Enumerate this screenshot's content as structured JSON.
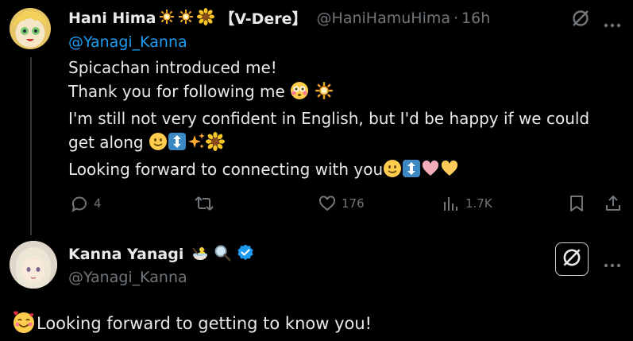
{
  "post1": {
    "author_name": "Hani Hima",
    "name_tag": "【V-Dere】",
    "handle": "@HaniHamuHima",
    "separator": "·",
    "time": "16h",
    "reply_to": "@Yanagi_Kanna",
    "lines": [
      "Spicachan introduced me!",
      "Thank you for following me",
      "I'm still not very confident in English, but I'd be happy if we could",
      "get along",
      "Looking forward to connecting with you"
    ],
    "actions": {
      "reply_count": "4",
      "retweet_count": "",
      "like_count": "176",
      "view_count": "1.7K"
    }
  },
  "post2": {
    "author_name": "Kanna Yanagi",
    "handle": "@Yanagi_Kanna",
    "text": "Looking forward to getting to know you!"
  },
  "colors": {
    "background": "#000000",
    "text": "#e7e9ea",
    "muted": "#71767b",
    "link": "#1d9bf0",
    "verified": "#1d9bf0"
  }
}
